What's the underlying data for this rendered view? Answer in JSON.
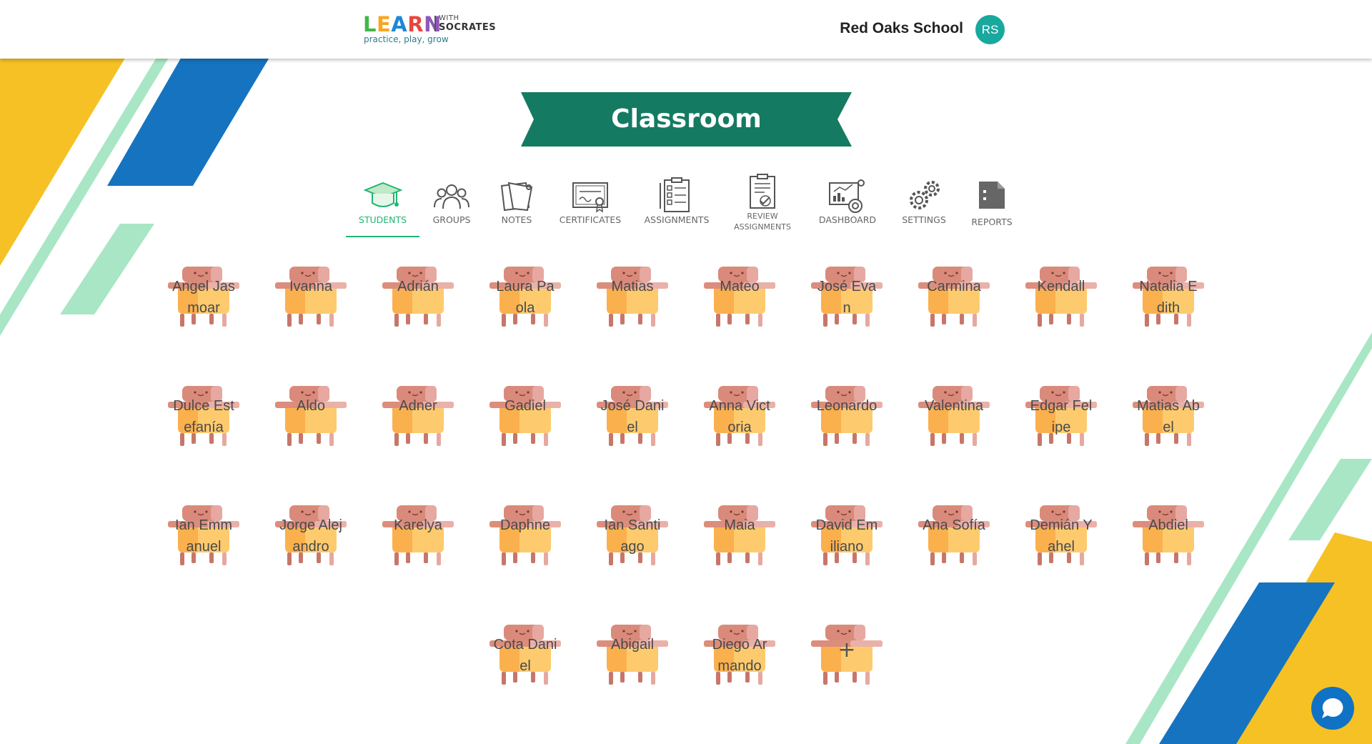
{
  "header": {
    "logo_letters": [
      "L",
      "E",
      "A",
      "R",
      "N"
    ],
    "logo_with": "WITH",
    "logo_socrates": "SOCRATES",
    "logo_tagline": "practice, play, grow",
    "school_name": "Red Oaks School",
    "avatar_initials": "RS"
  },
  "title": "Classroom",
  "tabs": [
    {
      "label": "STUDENTS",
      "icon": "graduation-cap-icon",
      "active": true
    },
    {
      "label": "GROUPS",
      "icon": "people-icon"
    },
    {
      "label": "NOTES",
      "icon": "sticky-notes-icon"
    },
    {
      "label": "CERTIFICATES",
      "icon": "certificate-icon"
    },
    {
      "label": "ASSIGNMENTS",
      "icon": "checklist-icon"
    },
    {
      "label": "REVIEW ASSIGNMENTS",
      "label_line1": "REVIEW",
      "label_line2": "ASSIGNMENTS",
      "icon": "review-document-icon"
    },
    {
      "label": "DASHBOARD",
      "icon": "dashboard-chart-icon"
    },
    {
      "label": "SETTINGS",
      "icon": "gears-icon"
    },
    {
      "label": "REPORTS",
      "icon": "report-file-icon"
    }
  ],
  "students": [
    "Angel Jasmoar",
    "Ivanna",
    "Adrián",
    "Laura Paola",
    "Matias",
    "Mateo",
    "José Evan",
    "Carmina",
    "Kendall",
    "Natalia Edith",
    "Dulce Estefanía",
    "Aldo",
    "Adner",
    "Gadiel",
    "José Daniel",
    "Anna Victoria",
    "Leonardo",
    "Valentina",
    "Edgar Felipe",
    "Matias Abel",
    "Ian Emmanuel",
    "Jorge Alejandro",
    "Karelya",
    "Daphne",
    "Ian Santiago",
    "Maia",
    "David Emiliano",
    "Ana Sofía",
    "Demián Yahel",
    "Abdiel",
    "Cota Daniel",
    "Abigail",
    "Diego Armando"
  ],
  "add_student_symbol": "+",
  "colors": {
    "brand_green": "#157a62",
    "active_tab": "#22b573",
    "avatar": "#19a89d",
    "stripe_yellow": "#f5c124",
    "stripe_blue": "#1673c0",
    "stripe_mint": "#a8e6c5",
    "chat": "#0f72c4"
  }
}
